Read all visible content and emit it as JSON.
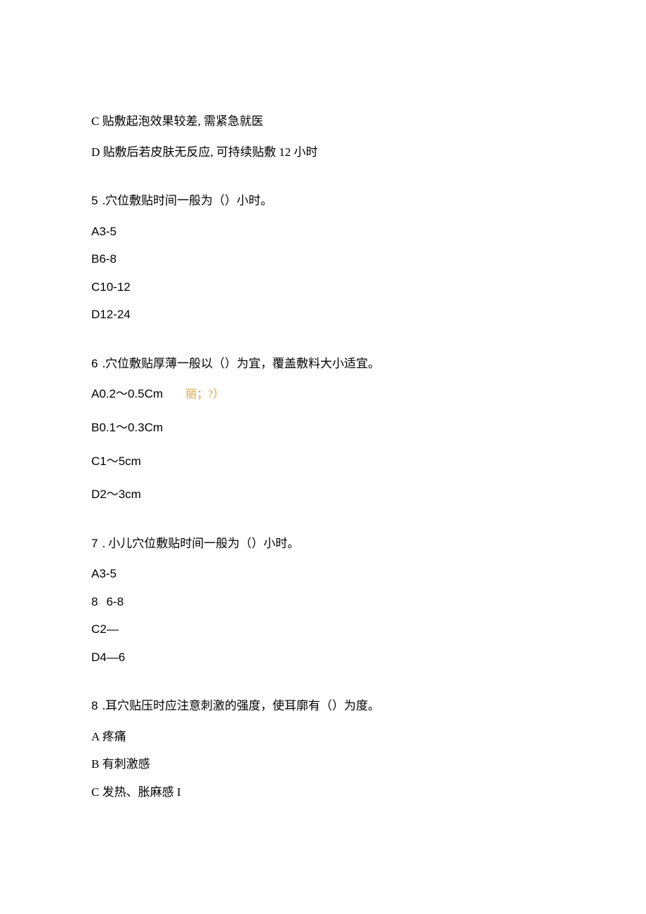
{
  "lines": {
    "pre1": "C 贴敷起泡效果较差, 需紧急就医",
    "pre2": "D 贴敷后若皮肤无反应, 可持续贴敷 12 小时"
  },
  "q5": {
    "num": "5",
    "text": " .穴位敷贴时间一般为（）小时。",
    "a": "A3-5",
    "b": "B6-8",
    "c": "C10-12",
    "d": "D12-24"
  },
  "q6": {
    "num": "6",
    "text": " .穴位敷贴厚薄一般以（）为宜，覆盖敷料大小适宜。",
    "a": "A0.2～0.5Cm",
    "note": "丽；?）",
    "b": "B0.1～0.3Cm",
    "c": "C1～5cm",
    "d": "D2～3cm"
  },
  "q7": {
    "num": "7",
    "text": " . 小儿穴位敷贴时间一般为（）小时。",
    "a": "A3-5",
    "b_num": "8",
    "b_text": "6-8",
    "c": "C2—",
    "d": "D4—6"
  },
  "q8": {
    "num": "8",
    "text": " .耳穴贴压时应注意刺激的强度，使耳廓有（）为度。",
    "a": "A 疼痛",
    "b": "B 有刺激感",
    "c": "C 发热、胀麻感 I"
  }
}
